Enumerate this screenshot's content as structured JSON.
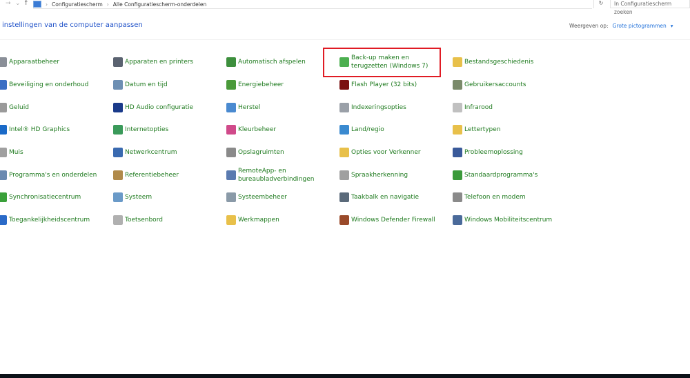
{
  "address": {
    "crumbs": [
      "Configuratiescherm",
      "Alle Configuratiescherm-onderdelen"
    ],
    "search_placeholder": "In Configuratiescherm zoeken"
  },
  "header": {
    "title": "instellingen van de computer aanpassen",
    "view_label": "Weergeven op:",
    "view_value": "Grote pictogrammen"
  },
  "items": [
    {
      "label": "Apparaatbeheer",
      "color": "#8a8f98"
    },
    {
      "label": "Apparaten en printers",
      "color": "#5a6270"
    },
    {
      "label": "Automatisch afspelen",
      "color": "#3d8f3d"
    },
    {
      "label": "Back-up maken en terugzetten (Windows 7)",
      "color": "#4caf50"
    },
    {
      "label": "Bestandsgeschiedenis",
      "color": "#e8c04a"
    },
    {
      "label": "Beveiliging en onderhoud",
      "color": "#3a6fc4"
    },
    {
      "label": "Datum en tijd",
      "color": "#6d8fb3"
    },
    {
      "label": "Energiebeheer",
      "color": "#4a9a3a"
    },
    {
      "label": "Flash Player (32 bits)",
      "color": "#7a1010"
    },
    {
      "label": "Gebruikersaccounts",
      "color": "#7a8a6a"
    },
    {
      "label": "Geluid",
      "color": "#9a9a9a"
    },
    {
      "label": "HD Audio configuratie",
      "color": "#1a3a8a"
    },
    {
      "label": "Herstel",
      "color": "#4a8ad0"
    },
    {
      "label": "Indexeringsopties",
      "color": "#9aa0a8"
    },
    {
      "label": "Infrarood",
      "color": "#c0c0c0"
    },
    {
      "label": "Intel® HD Graphics",
      "color": "#1a6ac8"
    },
    {
      "label": "Internetopties",
      "color": "#3a9a5a"
    },
    {
      "label": "Kleurbeheer",
      "color": "#d04a8a"
    },
    {
      "label": "Land/regio",
      "color": "#3a8ad0"
    },
    {
      "label": "Lettertypen",
      "color": "#e8c04a"
    },
    {
      "label": "Muis",
      "color": "#a0a0a0"
    },
    {
      "label": "Netwerkcentrum",
      "color": "#3a6ab0"
    },
    {
      "label": "Opslagruimten",
      "color": "#8a8a8a"
    },
    {
      "label": "Opties voor Verkenner",
      "color": "#e8c04a"
    },
    {
      "label": "Probleemoplossing",
      "color": "#3a5a9a"
    },
    {
      "label": "Programma's en onderdelen",
      "color": "#6a8ab0"
    },
    {
      "label": "Referentiebeheer",
      "color": "#b08a4a"
    },
    {
      "label": "RemoteApp- en bureaubladverbindingen",
      "color": "#5a7ab0"
    },
    {
      "label": "Spraakherkenning",
      "color": "#a0a0a0"
    },
    {
      "label": "Standaardprogramma's",
      "color": "#3a9a3a"
    },
    {
      "label": "Synchronisatiecentrum",
      "color": "#3aa03a"
    },
    {
      "label": "Systeem",
      "color": "#6a9ac8"
    },
    {
      "label": "Systeembeheer",
      "color": "#8a9aa8"
    },
    {
      "label": "Taakbalk en navigatie",
      "color": "#5a6a7a"
    },
    {
      "label": "Telefoon en modem",
      "color": "#8a8a8a"
    },
    {
      "label": "Toegankelijkheidscentrum",
      "color": "#2a6ac8"
    },
    {
      "label": "Toetsenbord",
      "color": "#b0b0b0"
    },
    {
      "label": "Werkmappen",
      "color": "#e8c04a"
    },
    {
      "label": "Windows Defender Firewall",
      "color": "#9a4a2a"
    },
    {
      "label": "Windows Mobiliteitscentrum",
      "color": "#4a6a9a"
    }
  ]
}
